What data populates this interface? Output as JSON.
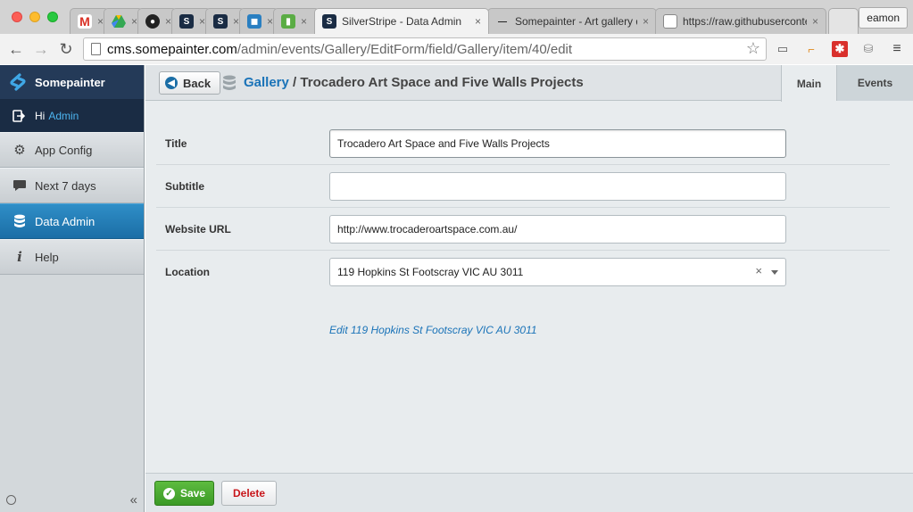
{
  "browser": {
    "tabs": [
      {
        "icon": "gmail-icon",
        "title": ""
      },
      {
        "icon": "drive-icon",
        "title": ""
      },
      {
        "icon": "github-icon",
        "title": ""
      },
      {
        "icon": "silverstripe-icon",
        "title": ""
      },
      {
        "icon": "silverstripe-icon",
        "title": ""
      },
      {
        "icon": "app-icon",
        "title": ""
      },
      {
        "icon": "trello-icon",
        "title": ""
      },
      {
        "icon": "silverstripe-icon",
        "title": "SilverStripe - Data Admin"
      },
      {
        "icon": "dash-icon",
        "title": "Somepainter - Art gallery d"
      },
      {
        "icon": "page-icon",
        "title": "https://raw.githubuserconte"
      }
    ],
    "user": "eamon",
    "url_host": "cms.somepainter.com",
    "url_path": "/admin/events/Gallery/EditForm/field/Gallery/item/40/edit"
  },
  "sidebar": {
    "brand": "Somepainter",
    "greeting": "Hi",
    "username": "Admin",
    "items": [
      {
        "label": "App Config",
        "icon": "gear-icon"
      },
      {
        "label": "Next 7 days",
        "icon": "chat-bubble-icon"
      },
      {
        "label": "Data Admin",
        "icon": "database-icon"
      },
      {
        "label": "Help",
        "icon": "info-icon"
      }
    ],
    "collapse": "«"
  },
  "header": {
    "back_label": "Back",
    "breadcrumb_link": "Gallery",
    "breadcrumb_sep": " / ",
    "breadcrumb_title": "Trocadero Art Space and Five Walls Projects",
    "tabs": [
      "Main",
      "Events"
    ]
  },
  "form": {
    "title_label": "Title",
    "title_value": "Trocadero Art Space and Five Walls Projects",
    "subtitle_label": "Subtitle",
    "subtitle_value": "",
    "website_label": "Website URL",
    "website_value": "http://www.trocaderoartspace.com.au/",
    "location_label": "Location",
    "location_value": "119 Hopkins St Footscray VIC AU 3011",
    "location_clear": "×",
    "location_edit_link": "Edit 119 Hopkins St Footscray VIC AU 3011"
  },
  "actions": {
    "save_label": "Save",
    "delete_label": "Delete"
  }
}
